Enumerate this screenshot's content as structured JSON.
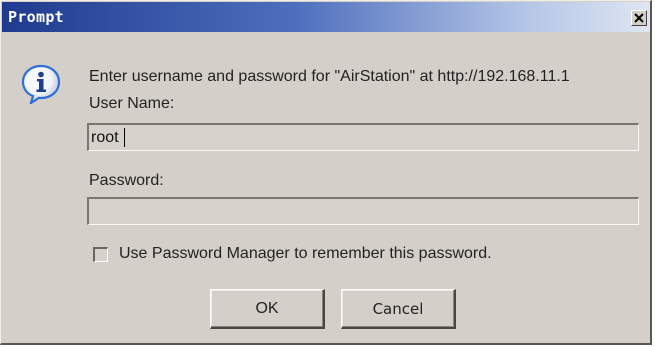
{
  "window": {
    "title": "Prompt",
    "close_symbol": "x"
  },
  "dialog": {
    "icon": "info-icon",
    "message": "Enter username and password for \"AirStation\" at http://192.168.11.1",
    "username_label": "User Name:",
    "username_value": "root",
    "password_label": "Password:",
    "password_value": "",
    "remember_label": "Use Password Manager to remember this password.",
    "remember_checked": false
  },
  "buttons": {
    "ok_label": "OK",
    "cancel_label": "Cancel"
  },
  "colors": {
    "titlebar_start": "#1f3a8e",
    "titlebar_end": "#dfe6f3",
    "dialog_bg": "#d4cfc9",
    "info_icon_blue": "#2f6fd6"
  }
}
